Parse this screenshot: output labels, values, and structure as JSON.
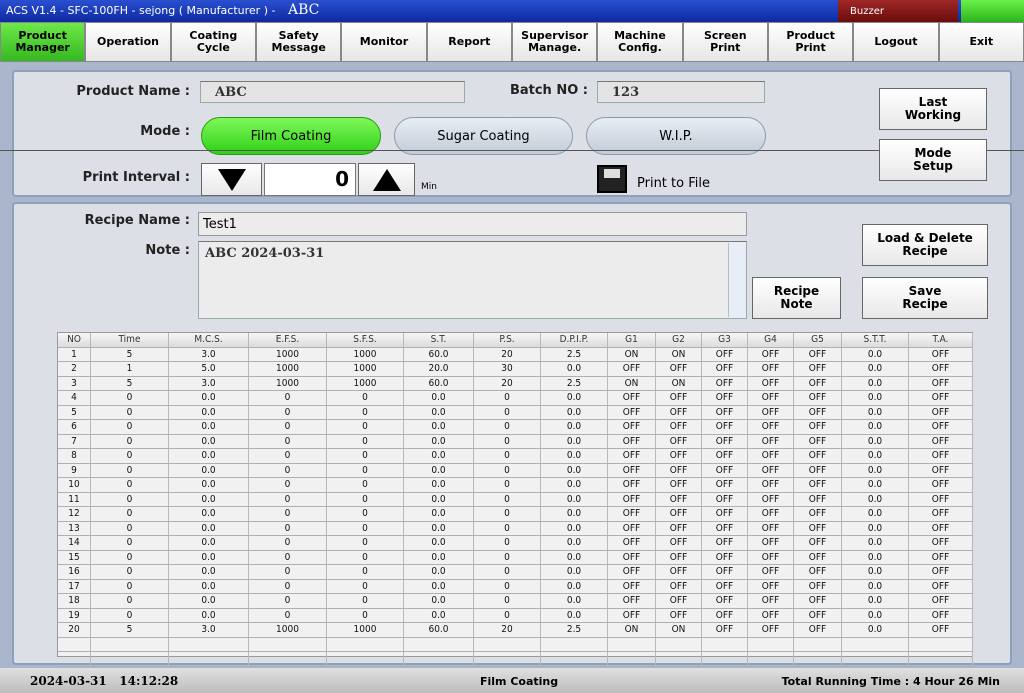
{
  "titlebar": {
    "title": "ACS V1.4 - SFC-100FH - sejong ( Manufacturer ) -",
    "product": "ABC",
    "buzzer": "Buzzer"
  },
  "nav": [
    {
      "label": "Product\nManager",
      "active": true
    },
    {
      "label": "Operation"
    },
    {
      "label": "Coating\nCycle"
    },
    {
      "label": "Safety\nMessage"
    },
    {
      "label": "Monitor"
    },
    {
      "label": "Report"
    },
    {
      "label": "Supervisor\nManage."
    },
    {
      "label": "Machine\nConfig."
    },
    {
      "label": "Screen\nPrint"
    },
    {
      "label": "Product\nPrint"
    },
    {
      "label": "Logout"
    },
    {
      "label": "Exit"
    }
  ],
  "top": {
    "product_name_label": "Product Name :",
    "product_name": "ABC",
    "batch_label": "Batch NO :",
    "batch": "123",
    "mode_label": "Mode :",
    "modes": [
      "Film Coating",
      "Sugar Coating",
      "W.I.P."
    ],
    "selected_mode": "Film Coating",
    "print_interval_label": "Print Interval :",
    "print_interval": "0",
    "unit": "Min",
    "print_to_file": "Print to File",
    "last_working": "Last\nWorking",
    "mode_setup": "Mode\nSetup"
  },
  "recipe": {
    "name_label": "Recipe Name :",
    "name": "Test1",
    "note_label": "Note :",
    "note": "ABC 2024-03-31",
    "recipe_note": "Recipe\nNote",
    "load_delete": "Load & Delete\nRecipe",
    "save": "Save\nRecipe"
  },
  "table": {
    "columns": [
      "NO",
      "Time",
      "M.C.S.",
      "E.F.S.",
      "S.F.S.",
      "S.T.",
      "P.S.",
      "D.P.I.P.",
      "G1",
      "G2",
      "G3",
      "G4",
      "G5",
      "S.T.T.",
      "T.A."
    ],
    "rows": [
      [
        "1",
        "5",
        "3.0",
        "1000",
        "1000",
        "60.0",
        "20",
        "2.5",
        "ON",
        "ON",
        "OFF",
        "OFF",
        "OFF",
        "0.0",
        "OFF"
      ],
      [
        "2",
        "1",
        "5.0",
        "1000",
        "1000",
        "20.0",
        "30",
        "0.0",
        "OFF",
        "OFF",
        "OFF",
        "OFF",
        "OFF",
        "0.0",
        "OFF"
      ],
      [
        "3",
        "5",
        "3.0",
        "1000",
        "1000",
        "60.0",
        "20",
        "2.5",
        "ON",
        "ON",
        "OFF",
        "OFF",
        "OFF",
        "0.0",
        "OFF"
      ],
      [
        "4",
        "0",
        "0.0",
        "0",
        "0",
        "0.0",
        "0",
        "0.0",
        "OFF",
        "OFF",
        "OFF",
        "OFF",
        "OFF",
        "0.0",
        "OFF"
      ],
      [
        "5",
        "0",
        "0.0",
        "0",
        "0",
        "0.0",
        "0",
        "0.0",
        "OFF",
        "OFF",
        "OFF",
        "OFF",
        "OFF",
        "0.0",
        "OFF"
      ],
      [
        "6",
        "0",
        "0.0",
        "0",
        "0",
        "0.0",
        "0",
        "0.0",
        "OFF",
        "OFF",
        "OFF",
        "OFF",
        "OFF",
        "0.0",
        "OFF"
      ],
      [
        "7",
        "0",
        "0.0",
        "0",
        "0",
        "0.0",
        "0",
        "0.0",
        "OFF",
        "OFF",
        "OFF",
        "OFF",
        "OFF",
        "0.0",
        "OFF"
      ],
      [
        "8",
        "0",
        "0.0",
        "0",
        "0",
        "0.0",
        "0",
        "0.0",
        "OFF",
        "OFF",
        "OFF",
        "OFF",
        "OFF",
        "0.0",
        "OFF"
      ],
      [
        "9",
        "0",
        "0.0",
        "0",
        "0",
        "0.0",
        "0",
        "0.0",
        "OFF",
        "OFF",
        "OFF",
        "OFF",
        "OFF",
        "0.0",
        "OFF"
      ],
      [
        "10",
        "0",
        "0.0",
        "0",
        "0",
        "0.0",
        "0",
        "0.0",
        "OFF",
        "OFF",
        "OFF",
        "OFF",
        "OFF",
        "0.0",
        "OFF"
      ],
      [
        "11",
        "0",
        "0.0",
        "0",
        "0",
        "0.0",
        "0",
        "0.0",
        "OFF",
        "OFF",
        "OFF",
        "OFF",
        "OFF",
        "0.0",
        "OFF"
      ],
      [
        "12",
        "0",
        "0.0",
        "0",
        "0",
        "0.0",
        "0",
        "0.0",
        "OFF",
        "OFF",
        "OFF",
        "OFF",
        "OFF",
        "0.0",
        "OFF"
      ],
      [
        "13",
        "0",
        "0.0",
        "0",
        "0",
        "0.0",
        "0",
        "0.0",
        "OFF",
        "OFF",
        "OFF",
        "OFF",
        "OFF",
        "0.0",
        "OFF"
      ],
      [
        "14",
        "0",
        "0.0",
        "0",
        "0",
        "0.0",
        "0",
        "0.0",
        "OFF",
        "OFF",
        "OFF",
        "OFF",
        "OFF",
        "0.0",
        "OFF"
      ],
      [
        "15",
        "0",
        "0.0",
        "0",
        "0",
        "0.0",
        "0",
        "0.0",
        "OFF",
        "OFF",
        "OFF",
        "OFF",
        "OFF",
        "0.0",
        "OFF"
      ],
      [
        "16",
        "0",
        "0.0",
        "0",
        "0",
        "0.0",
        "0",
        "0.0",
        "OFF",
        "OFF",
        "OFF",
        "OFF",
        "OFF",
        "0.0",
        "OFF"
      ],
      [
        "17",
        "0",
        "0.0",
        "0",
        "0",
        "0.0",
        "0",
        "0.0",
        "OFF",
        "OFF",
        "OFF",
        "OFF",
        "OFF",
        "0.0",
        "OFF"
      ],
      [
        "18",
        "0",
        "0.0",
        "0",
        "0",
        "0.0",
        "0",
        "0.0",
        "OFF",
        "OFF",
        "OFF",
        "OFF",
        "OFF",
        "0.0",
        "OFF"
      ],
      [
        "19",
        "0",
        "0.0",
        "0",
        "0",
        "0.0",
        "0",
        "0.0",
        "OFF",
        "OFF",
        "OFF",
        "OFF",
        "OFF",
        "0.0",
        "OFF"
      ],
      [
        "20",
        "5",
        "3.0",
        "1000",
        "1000",
        "60.0",
        "20",
        "2.5",
        "ON",
        "ON",
        "OFF",
        "OFF",
        "OFF",
        "0.0",
        "OFF"
      ]
    ]
  },
  "status": {
    "datetime": "2024-03-31   14:12:28",
    "mode": "Film Coating",
    "running": "Total Running Time : 4 Hour 26 Min"
  }
}
